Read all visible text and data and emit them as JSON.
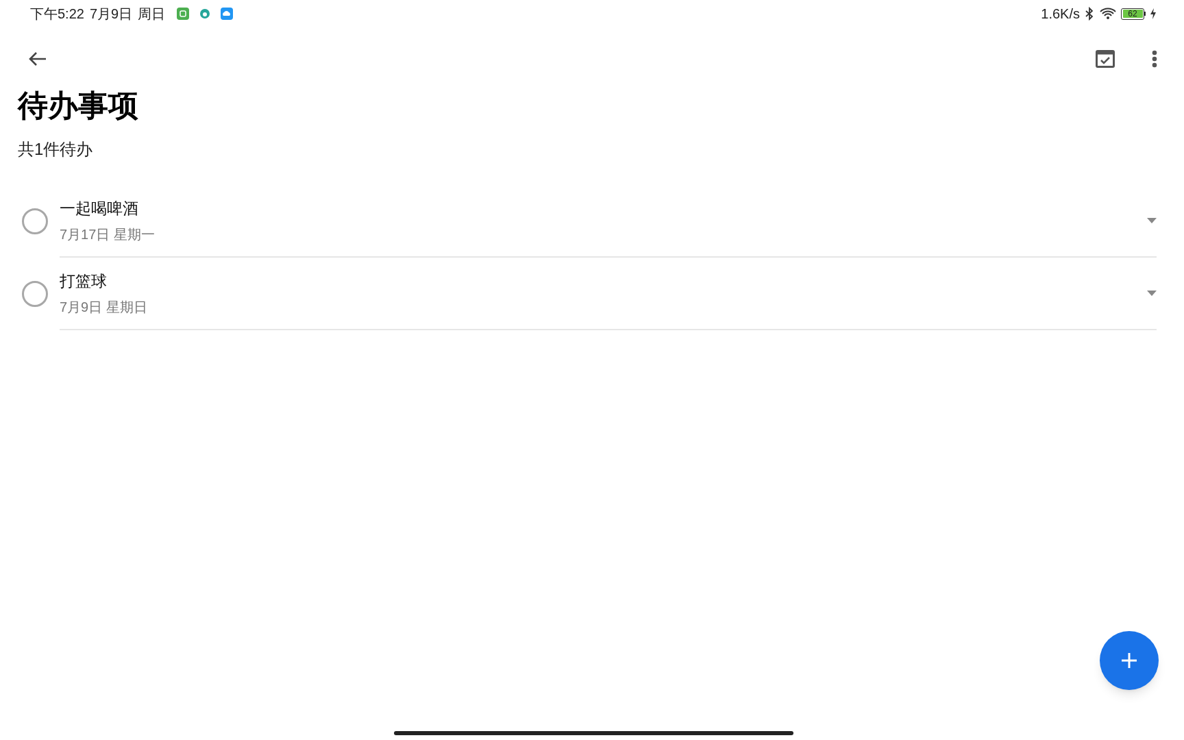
{
  "status_bar": {
    "time": "下午5:22",
    "date": "7月9日",
    "weekday": "周日",
    "network_speed": "1.6K/s",
    "battery": "62"
  },
  "title": "待办事项",
  "summary": "共1件待办",
  "todos": [
    {
      "title": "一起喝啤酒",
      "date": "7月17日 星期一",
      "checked": false
    },
    {
      "title": "打篮球",
      "date": "7月9日 星期日",
      "checked": false
    }
  ]
}
